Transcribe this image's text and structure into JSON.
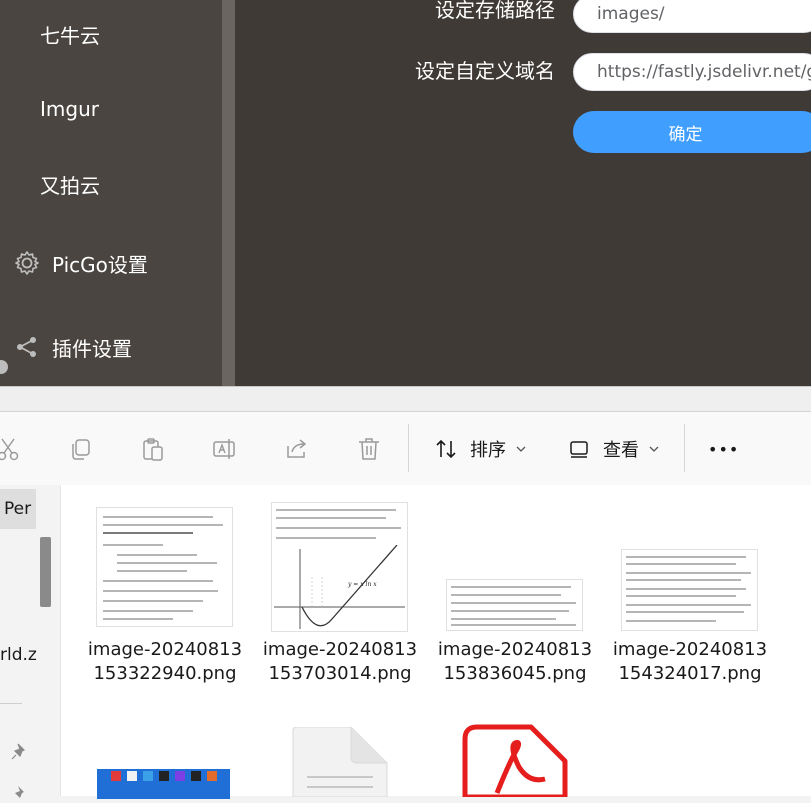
{
  "picgo": {
    "sidebar": {
      "items": [
        {
          "label": "七牛云",
          "icon": ""
        },
        {
          "label": "Imgur",
          "icon": ""
        },
        {
          "label": "又拍云",
          "icon": ""
        },
        {
          "label": "PicGo设置",
          "icon": "gear-icon"
        },
        {
          "label": "插件设置",
          "icon": "share-icon"
        }
      ]
    },
    "form": {
      "path_label": "设定存储路径",
      "path_value": "images/",
      "domain_label": "设定自定义域名",
      "domain_value": "https://fastly.jsdelivr.net/g",
      "confirm_label": "确定"
    },
    "colors": {
      "accent": "#409eff",
      "sidebar_bg": "#4a4540",
      "main_bg": "#3f3a36"
    }
  },
  "explorer": {
    "toolbar": {
      "icons": [
        "cut-icon",
        "copy-icon",
        "paste-icon",
        "rename-icon",
        "share-icon",
        "delete-icon"
      ],
      "sort_label": "排序",
      "view_label": "查看",
      "more_label": "•••"
    },
    "nav": {
      "selected_text": "Per",
      "file_text": "rld.z"
    },
    "files": [
      {
        "name": "image-20240813153322940.png"
      },
      {
        "name": "image-20240813153703014.png"
      },
      {
        "name": "image-20240813153836045.png"
      },
      {
        "name": "image-20240813154324017.png"
      }
    ],
    "graph_label": "y = x ln x"
  }
}
